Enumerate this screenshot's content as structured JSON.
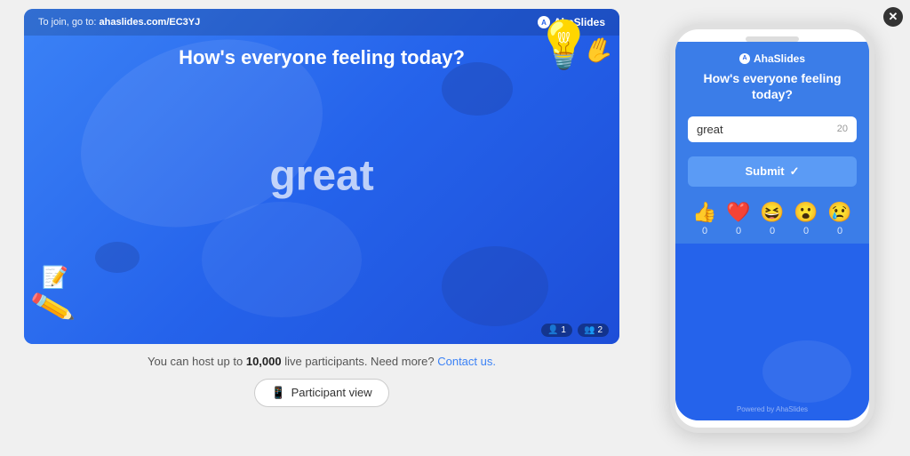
{
  "slide": {
    "join_url_prefix": "To join, go to: ",
    "join_url": "ahaslides.com/EC3YJ",
    "logo": "AhaSlides",
    "question": "How's everyone feeling today?",
    "answer": "great",
    "stats": {
      "person1": "1",
      "person2": "2"
    }
  },
  "below_slide": {
    "text_prefix": "You can host up to ",
    "participants": "10,000",
    "text_middle": " live participants. Need more?",
    "contact_link": "Contact us."
  },
  "participant_view_btn": "Participant view",
  "phone": {
    "logo": "AhaSlides",
    "question": "How's everyone feeling today?",
    "input_value": "great",
    "char_count": "20",
    "submit_label": "Submit",
    "submit_checkmark": "✓",
    "reactions": [
      {
        "emoji": "👍",
        "count": "0"
      },
      {
        "emoji": "❤️",
        "count": "0"
      },
      {
        "emoji": "😆",
        "count": "0"
      },
      {
        "emoji": "😮",
        "count": "0"
      },
      {
        "emoji": "😢",
        "count": "0"
      }
    ],
    "powered_by": "Powered by AhaSlides"
  },
  "close_btn": "✕"
}
